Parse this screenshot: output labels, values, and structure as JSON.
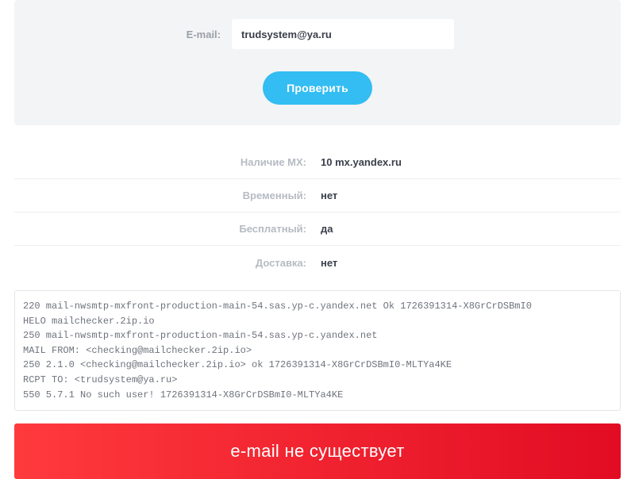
{
  "form": {
    "email_label": "E-mail:",
    "email_value": "trudsystem@ya.ru",
    "check_button": "Проверить"
  },
  "results": {
    "rows": [
      {
        "label": "Наличие MX:",
        "value": "10 mx.yandex.ru"
      },
      {
        "label": "Временный:",
        "value": "нет"
      },
      {
        "label": "Бесплатный:",
        "value": "да"
      },
      {
        "label": "Доставка:",
        "value": "нет"
      }
    ]
  },
  "smtp_log": "220 mail-nwsmtp-mxfront-production-main-54.sas.yp-c.yandex.net Ok 1726391314-X8GrCrDSBmI0\nHELO mailchecker.2ip.io\n250 mail-nwsmtp-mxfront-production-main-54.sas.yp-c.yandex.net\nMAIL FROM: <checking@mailchecker.2ip.io>\n250 2.1.0 <checking@mailchecker.2ip.io> ok 1726391314-X8GrCrDSBmI0-MLTYa4KE\nRCPT TO: <trudsystem@ya.ru>\n550 5.7.1 No such user! 1726391314-X8GrCrDSBmI0-MLTYa4KE",
  "status": {
    "message": "e-mail не существует"
  },
  "colors": {
    "accent": "#33bdf2",
    "error_gradient_start": "#ff3a3d",
    "error_gradient_end": "#e20c23"
  }
}
